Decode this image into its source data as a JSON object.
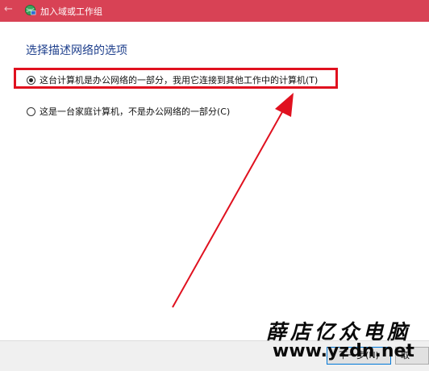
{
  "window": {
    "title": "加入域或工作组"
  },
  "page": {
    "heading": "选择描述网络的选项"
  },
  "options": [
    {
      "label": "这台计算机是办公网络的一部分，我用它连接到其他工作中的计算机(T)",
      "selected": true
    },
    {
      "label": "这是一台家庭计算机，不是办公网络的一部分(C)",
      "selected": false
    }
  ],
  "buttons": {
    "next": "下一步(N)",
    "cancel": "取"
  },
  "watermark": {
    "brand": "薛店亿众电脑",
    "url": "www.yzdn.net"
  },
  "colors": {
    "titlebar": "#d84255",
    "annotation": "#e0111f",
    "heading": "#1e3f8c"
  }
}
